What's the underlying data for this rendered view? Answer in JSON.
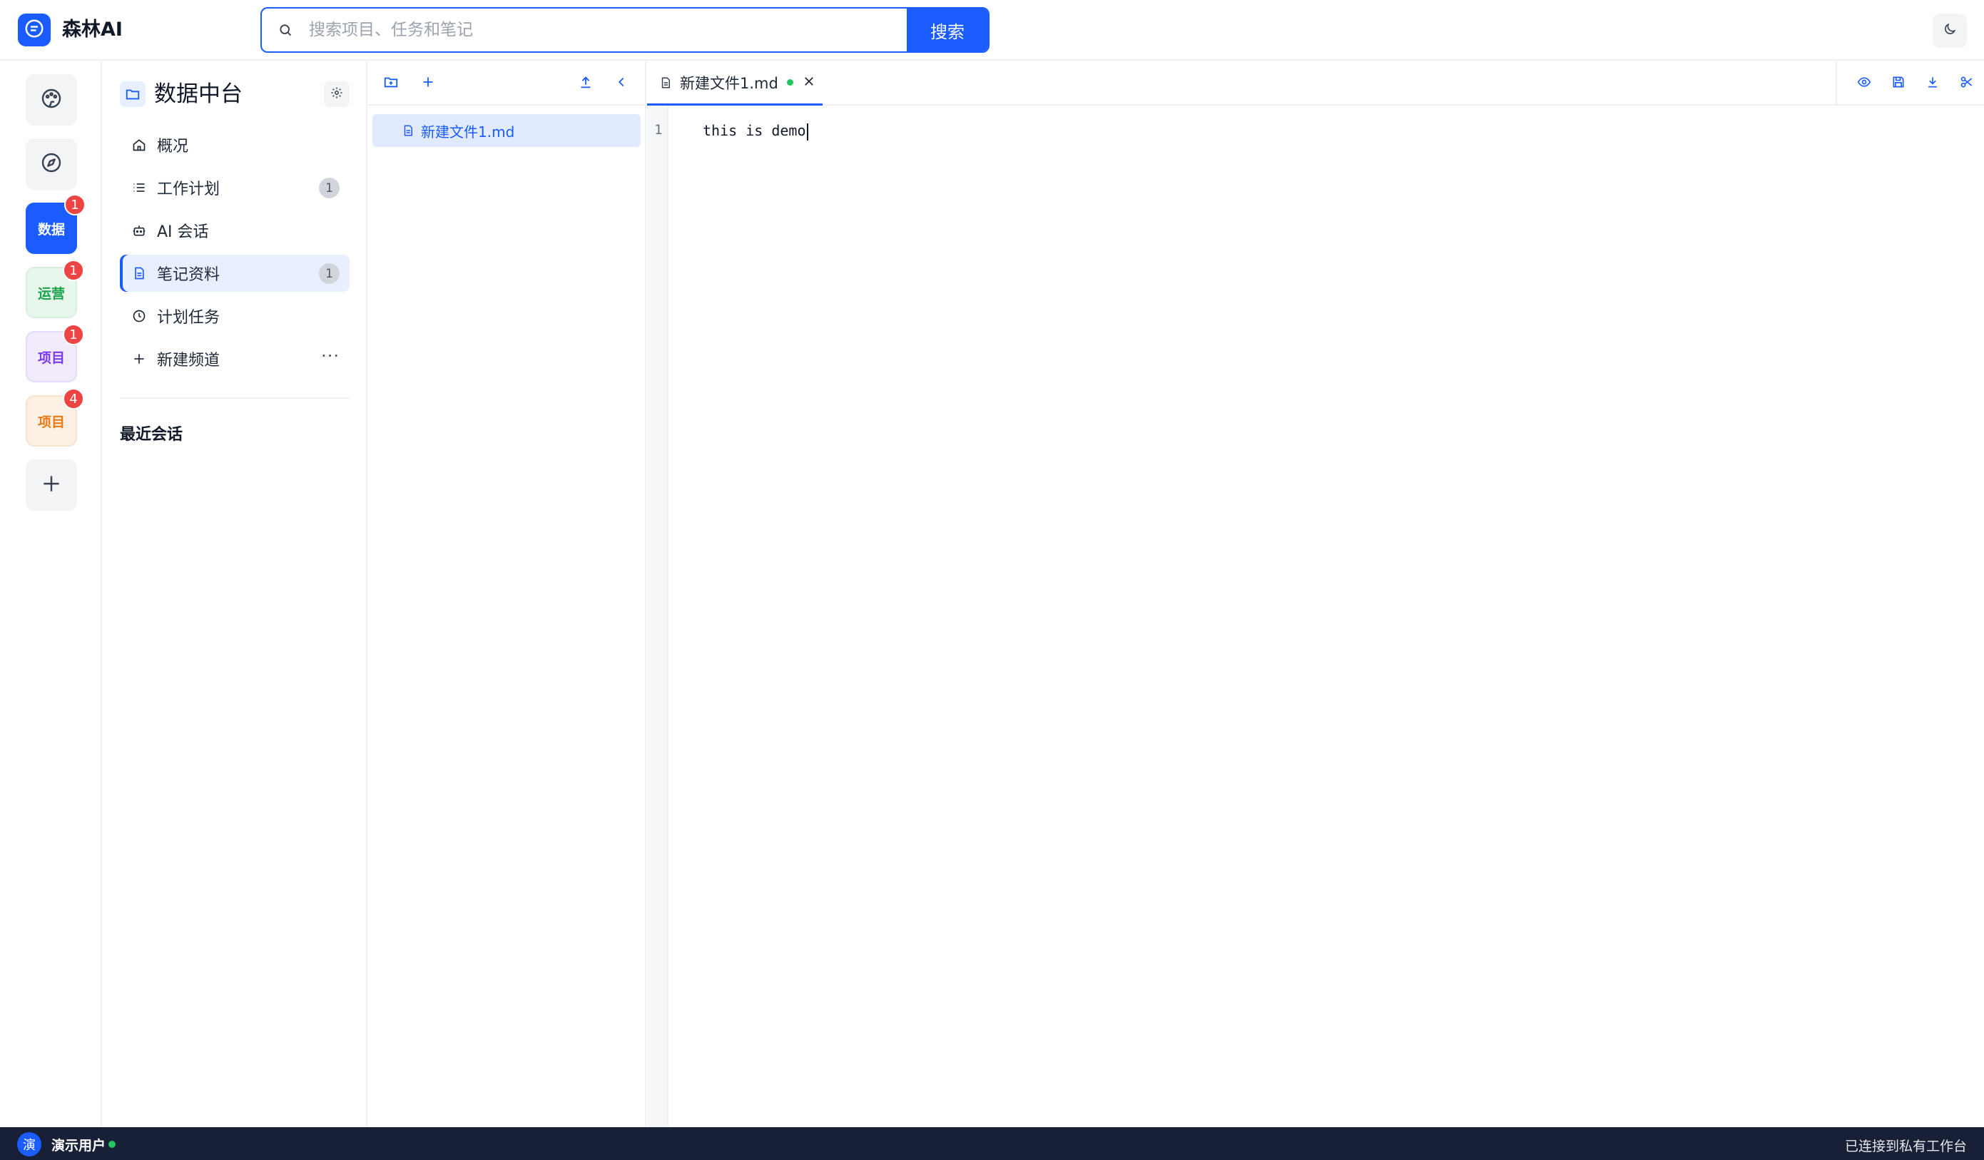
{
  "app": {
    "brand": "森林AI",
    "accent": "#1a5cff"
  },
  "search": {
    "placeholder": "搜索项目、任务和笔记",
    "value": "",
    "button": "搜索"
  },
  "rail": {
    "items": [
      {
        "name": "dashboard",
        "icon": "palette-icon"
      },
      {
        "name": "explore",
        "icon": "compass-icon"
      },
      {
        "label": "数据",
        "badge": "1",
        "bg": "#1a5cff",
        "fg": "#ffffff"
      },
      {
        "label": "运营",
        "badge": "1",
        "bg": "#e8f7ec",
        "fg": "#16a34a"
      },
      {
        "label": "项目",
        "badge": "1",
        "bg": "#f1ebfb",
        "fg": "#7c3aed"
      },
      {
        "label": "项目",
        "badge": "4",
        "bg": "#fdf0e4",
        "fg": "#ea7a14"
      },
      {
        "name": "add",
        "icon": "plus-icon"
      }
    ]
  },
  "nav": {
    "title": "数据中台",
    "items": [
      {
        "label": "概况",
        "icon": "home-icon"
      },
      {
        "label": "工作计划",
        "icon": "list-icon",
        "count": "1"
      },
      {
        "label": "AI 会话",
        "icon": "robot-icon"
      },
      {
        "label": "笔记资料",
        "icon": "note-icon",
        "count": "1",
        "active": true
      },
      {
        "label": "计划任务",
        "icon": "clock-icon"
      },
      {
        "label": "新建频道",
        "icon": "plus-icon",
        "more": "···"
      }
    ],
    "recent_title": "最近会话"
  },
  "files": {
    "items": [
      {
        "label": "新建文件1.md",
        "selected": true
      }
    ]
  },
  "editor": {
    "tab": {
      "label": "新建文件1.md",
      "modified": true
    },
    "lines": [
      {
        "no": "1",
        "text": "this is demo"
      }
    ]
  },
  "status": {
    "avatar": "演",
    "user": "演示用户",
    "connection": "已连接到私有工作台"
  }
}
